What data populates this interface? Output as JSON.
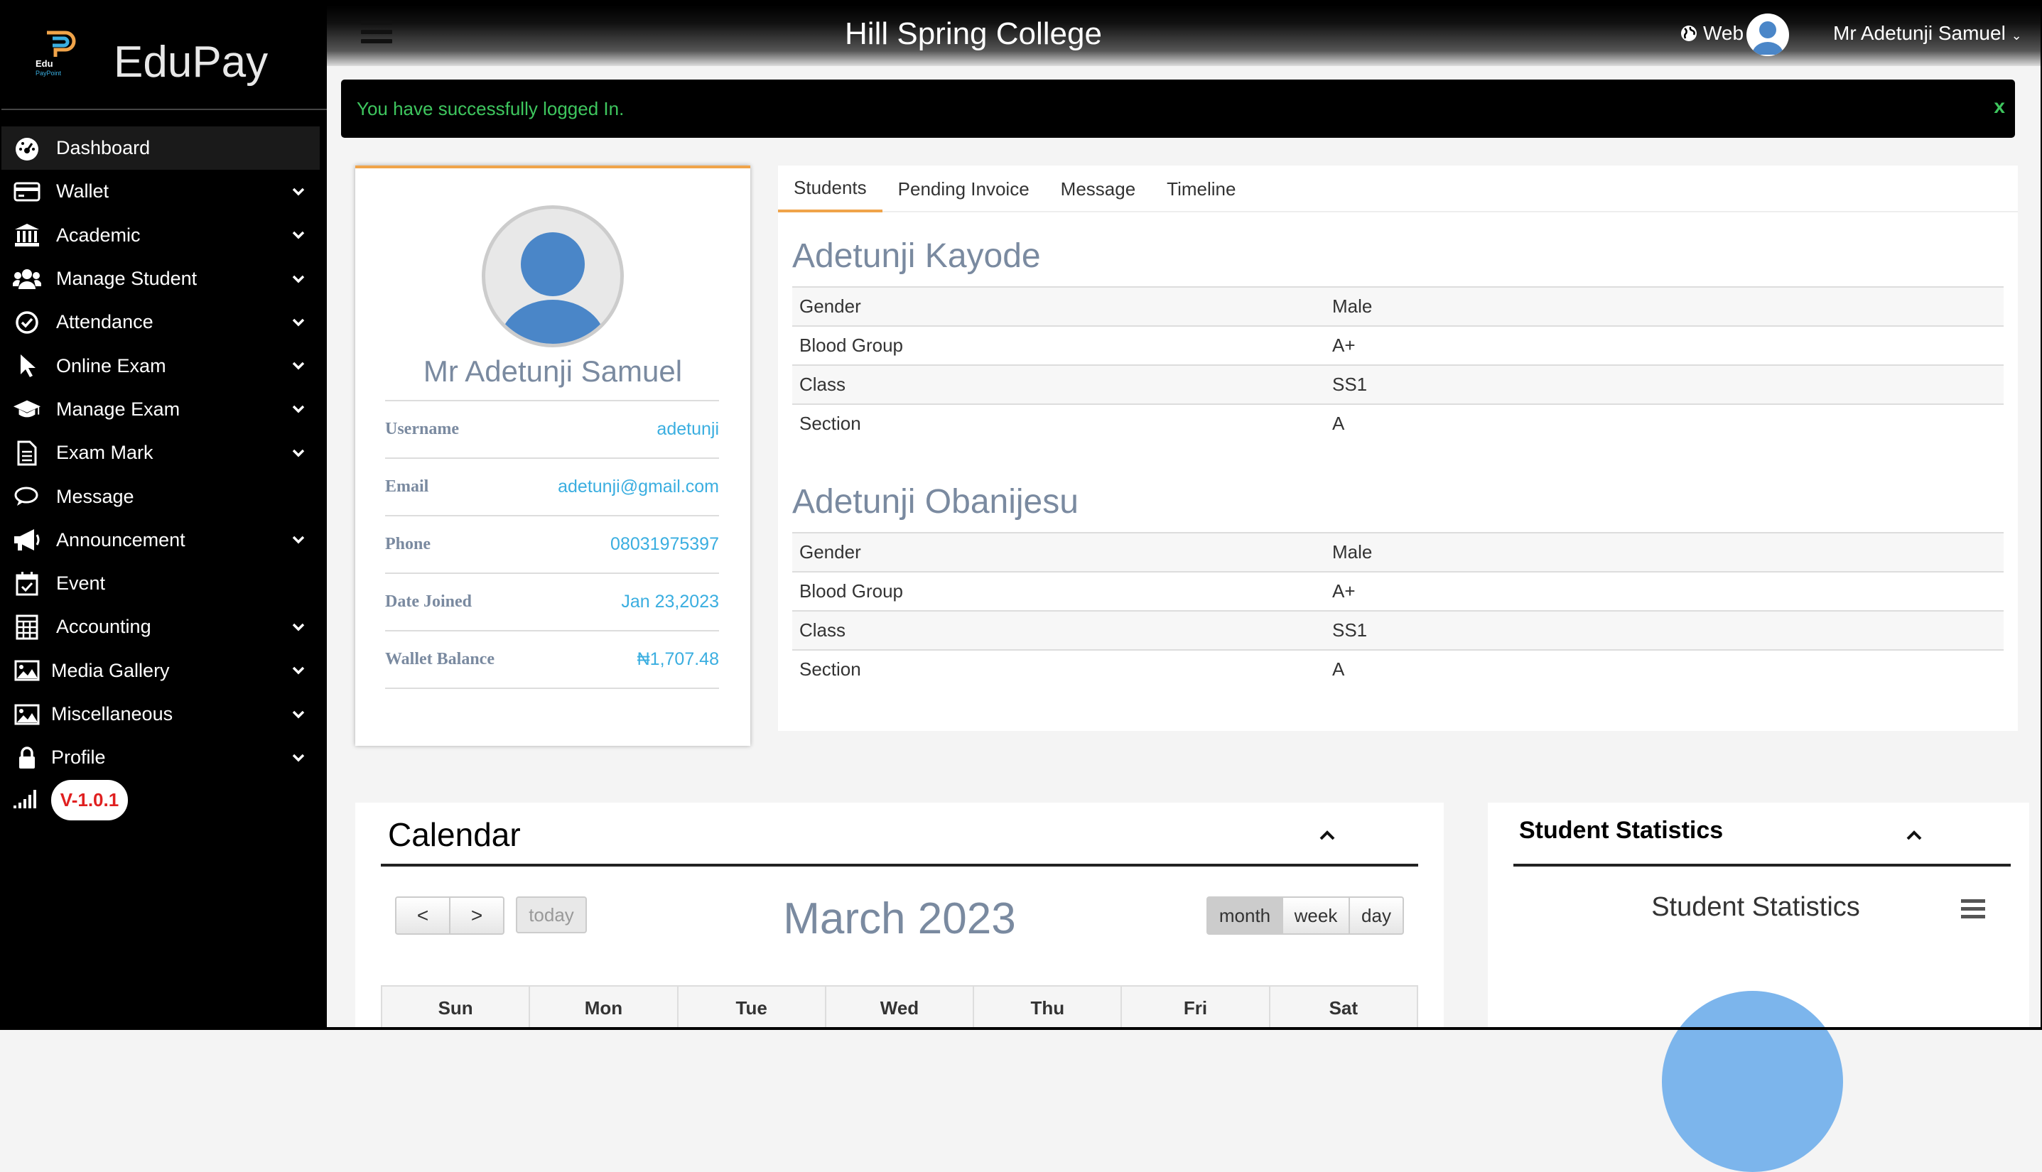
{
  "app": {
    "name": "EduPay",
    "logo_text": "Edu PayPoint"
  },
  "sidebar": {
    "items": [
      {
        "label": "Dashboard",
        "icon": "dashboard-icon",
        "dropdown": false
      },
      {
        "label": "Wallet",
        "icon": "wallet-icon",
        "dropdown": true
      },
      {
        "label": "Academic",
        "icon": "institution-icon",
        "dropdown": true
      },
      {
        "label": "Manage Student",
        "icon": "users-icon",
        "dropdown": true
      },
      {
        "label": "Attendance",
        "icon": "check-circle-icon",
        "dropdown": true
      },
      {
        "label": "Online Exam",
        "icon": "pointer-icon",
        "dropdown": true
      },
      {
        "label": "Manage Exam",
        "icon": "graduation-cap-icon",
        "dropdown": true
      },
      {
        "label": "Exam Mark",
        "icon": "document-icon",
        "dropdown": true
      },
      {
        "label": "Message",
        "icon": "chat-icon",
        "dropdown": false
      },
      {
        "label": "Announcement",
        "icon": "megaphone-icon",
        "dropdown": true
      },
      {
        "label": "Event",
        "icon": "calendar-check-icon",
        "dropdown": false
      },
      {
        "label": "Accounting",
        "icon": "calculator-icon",
        "dropdown": true
      },
      {
        "label": "Media Gallery",
        "icon": "image-icon",
        "dropdown": true
      },
      {
        "label": "Miscellaneous",
        "icon": "image-icon",
        "dropdown": true
      },
      {
        "label": "Profile",
        "icon": "lock-icon",
        "dropdown": true
      }
    ],
    "version": "V-1.0.1"
  },
  "header": {
    "title": "Hill Spring College",
    "web_label": "Web",
    "user_name": "Mr Adetunji Samuel"
  },
  "alert": {
    "message": "You have successfully logged In.",
    "close": "x"
  },
  "profile": {
    "name": "Mr Adetunji Samuel",
    "fields": [
      {
        "key": "Username",
        "value": "adetunji"
      },
      {
        "key": "Email",
        "value": "adetunji@gmail.com"
      },
      {
        "key": "Phone",
        "value": "08031975397"
      },
      {
        "key": "Date Joined",
        "value": "Jan 23,2023"
      },
      {
        "key": "Wallet Balance",
        "value": "₦1,707.48"
      }
    ]
  },
  "tabs": [
    "Students",
    "Pending Invoice",
    "Message",
    "Timeline"
  ],
  "students": [
    {
      "name": "Adetunji Kayode",
      "rows": [
        [
          "Gender",
          "Male"
        ],
        [
          "Blood Group",
          "A+"
        ],
        [
          "Class",
          "SS1"
        ],
        [
          "Section",
          "A"
        ]
      ]
    },
    {
      "name": "Adetunji Obanijesu",
      "rows": [
        [
          "Gender",
          "Male"
        ],
        [
          "Blood Group",
          "A+"
        ],
        [
          "Class",
          "SS1"
        ],
        [
          "Section",
          "A"
        ]
      ]
    }
  ],
  "calendar": {
    "title": "Calendar",
    "month": "March 2023",
    "today": "today",
    "prev": "<",
    "next": ">",
    "views": [
      "month",
      "week",
      "day"
    ],
    "active_view": "month",
    "days": [
      "Sun",
      "Mon",
      "Tue",
      "Wed",
      "Thu",
      "Fri",
      "Sat"
    ]
  },
  "stats": {
    "title": "Student Statistics",
    "chart_title": "Student Statistics"
  },
  "colors": {
    "accent": "#f0a44a",
    "link": "#3aaee0",
    "heading": "#7a8aa0",
    "alert_text": "#3ec65e"
  }
}
